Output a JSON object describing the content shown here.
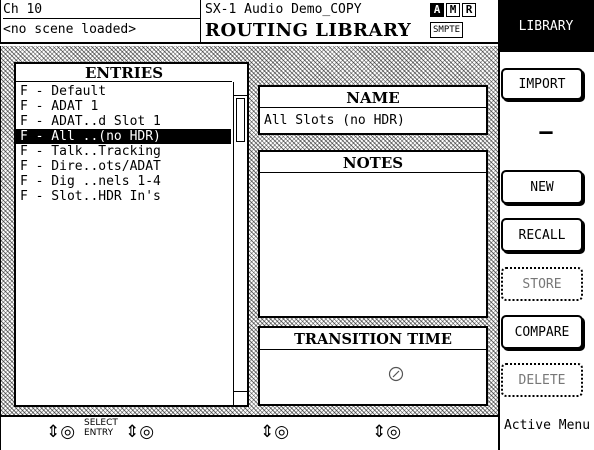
{
  "header": {
    "channel": "Ch 10",
    "project": "SX-1 Audio Demo_COPY",
    "scene_status": "<no scene loaded>",
    "screen_title": "ROUTING LIBRARY",
    "indicators": [
      "A",
      "M",
      "R"
    ],
    "smpte": "SMPTE"
  },
  "sidebar": {
    "tab_label": "LIBRARY",
    "import_label": "IMPORT",
    "separator": "—",
    "new_label": "NEW",
    "recall_label": "RECALL",
    "store_label": "STORE",
    "compare_label": "COMPARE",
    "delete_label": "DELETE"
  },
  "entries": {
    "title": "ENTRIES",
    "items": [
      "F - Default",
      "F - ADAT 1",
      "F - ADAT..d Slot 1",
      "F - All ..(no HDR)",
      "F - Talk..Tracking",
      "F - Dire..ots/ADAT",
      "F - Dig ..nels 1-4",
      "F - Slot..HDR In's"
    ],
    "selected_index": 3
  },
  "name_panel": {
    "title": "NAME",
    "value": "All Slots (no HDR)"
  },
  "notes_panel": {
    "title": "NOTES",
    "value": ""
  },
  "transition_panel": {
    "title": "TRANSITION TIME",
    "value_icon": "clock-icon"
  },
  "footer": {
    "knob1_label": "SELECT ENTRY",
    "active_menu": "Active Menu"
  }
}
